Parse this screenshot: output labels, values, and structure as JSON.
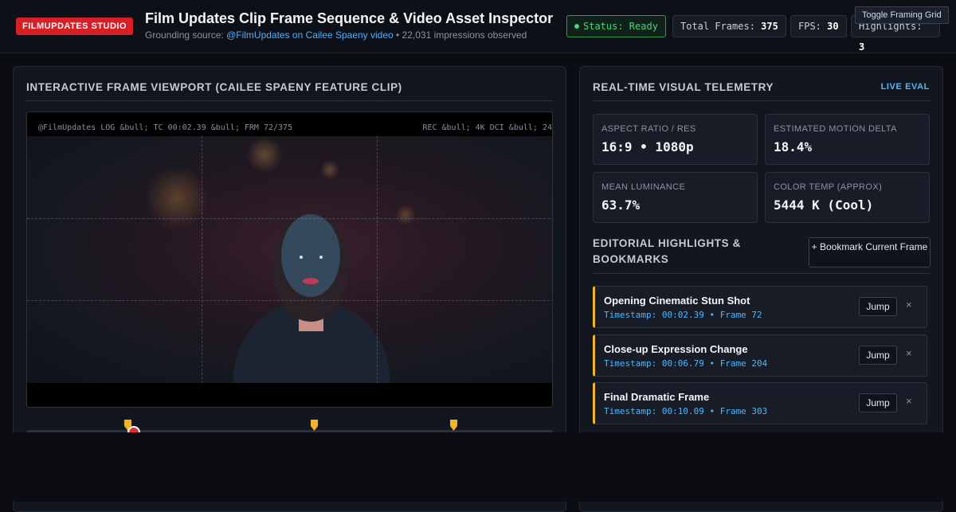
{
  "header": {
    "brand": "FILMUPDATES STUDIO",
    "title": "Film Updates Clip Frame Sequence & Video Asset Inspector",
    "subtitle_prefix": "Grounding source: ",
    "subtitle_link": "@FilmUpdates on Cailee Spaeny video",
    "subtitle_suffix": " • 22,031 impressions observed",
    "status": "Status: Ready",
    "total_frames_label": "Total Frames:",
    "total_frames": "375",
    "fps_label": "FPS:",
    "fps": "30",
    "highlights_label": "Highlights:",
    "highlights": "3",
    "toggle_grid": "Toggle Framing Grid"
  },
  "viewport": {
    "title": "Interactive Frame Viewport (Cailee Spaeny Feature Clip)",
    "overlay_left": "@FilmUpdates LOG &bull; TC 00:02.39 &bull; FRM 72/375",
    "overlay_right": "REC &bull; 4K DCI &bull; 24"
  },
  "telemetry": {
    "title": "Real-Time Visual Telemetry",
    "live": "LIVE EVAL",
    "cards": [
      {
        "label": "Aspect Ratio / Res",
        "value": "16:9 • 1080p"
      },
      {
        "label": "Estimated Motion Delta",
        "value": "18.4%"
      },
      {
        "label": "Mean Luminance",
        "value": "63.7%"
      },
      {
        "label": "Color Temp (Approx)",
        "value": "5444 K (Cool)"
      }
    ]
  },
  "highlights": {
    "title": "Editorial Highlights & Bookmarks",
    "bookmark_button": "+ Bookmark Current Frame",
    "jump_label": "Jump",
    "close_glyph": "×",
    "items": [
      {
        "name": "Opening Cinematic Stun Shot",
        "meta": "Timestamp: 00:02.39 • Frame 72"
      },
      {
        "name": "Close-up Expression Change",
        "meta": "Timestamp: 00:06.79 • Frame 204"
      },
      {
        "name": "Final Dramatic Frame",
        "meta": "Timestamp: 00:10.09 • Frame 303"
      }
    ]
  },
  "colors": {
    "accent_red": "#d61f26",
    "status_green": "#4cd27a",
    "link_blue": "#4fb0ff",
    "highlight_gold": "#f0b429"
  }
}
